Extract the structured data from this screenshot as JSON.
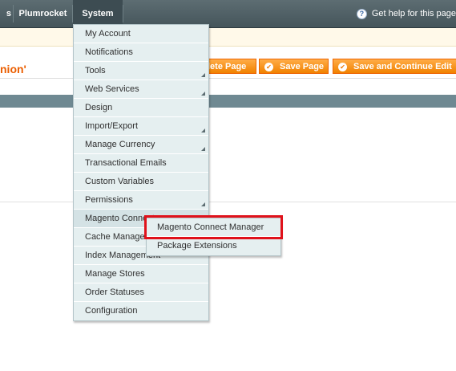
{
  "nav": {
    "items": [
      "s",
      "Plumrocket",
      "System"
    ],
    "help_label": "Get help for this page",
    "help_icon": "question-icon"
  },
  "page": {
    "title": "nion'"
  },
  "buttons": {
    "delete_label": "lete Page",
    "save_label": "Save Page",
    "save_continue_label": "Save and Continue Edit"
  },
  "system_menu": {
    "items": [
      {
        "label": "My Account",
        "has_submenu": false
      },
      {
        "label": "Notifications",
        "has_submenu": false
      },
      {
        "label": "Tools",
        "has_submenu": true
      },
      {
        "label": "Web Services",
        "has_submenu": true
      },
      {
        "label": "Design",
        "has_submenu": false
      },
      {
        "label": "Import/Export",
        "has_submenu": true
      },
      {
        "label": "Manage Currency",
        "has_submenu": true
      },
      {
        "label": "Transactional Emails",
        "has_submenu": false
      },
      {
        "label": "Custom Variables",
        "has_submenu": false
      },
      {
        "label": "Permissions",
        "has_submenu": true
      },
      {
        "label": "Magento Connect",
        "has_submenu": true
      },
      {
        "label": "Cache Management",
        "has_submenu": false
      },
      {
        "label": "Index Management",
        "has_submenu": false
      },
      {
        "label": "Manage Stores",
        "has_submenu": false
      },
      {
        "label": "Order Statuses",
        "has_submenu": false
      },
      {
        "label": "Configuration",
        "has_submenu": false
      }
    ]
  },
  "connect_submenu": {
    "items": [
      "Magento Connect Manager",
      "Package Extensions"
    ],
    "highlighted": "Magento Connect Manager"
  },
  "colors": {
    "accent_orange": "#eb5e00",
    "highlight_red": "#e0121b",
    "nav_bg": "#4f5f65",
    "menu_bg": "#e5eff0"
  }
}
